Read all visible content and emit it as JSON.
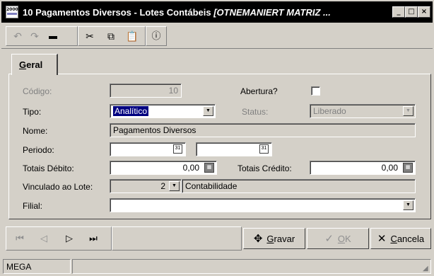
{
  "window": {
    "title_prefix": "10 Pagamentos Diversos - Lotes Contábeis",
    "title_company": "[OTNEMANIERT MATRIZ ...",
    "app_icon_text": "2000",
    "controls": {
      "minimize": "_",
      "maximize": "□",
      "close": "×"
    }
  },
  "toolbar": {
    "icons": [
      "undo-icon",
      "redo-icon",
      "delete-icon",
      "cut-icon",
      "copy-icon",
      "paste-icon",
      "info-icon"
    ]
  },
  "tab": {
    "label_underlined": "G",
    "label_rest": "eral"
  },
  "form": {
    "codigo": {
      "label": "Código:",
      "value": "10"
    },
    "abertura": {
      "label": "Abertura?",
      "checked": false
    },
    "tipo": {
      "label": "Tipo:",
      "value": "Analítico"
    },
    "status": {
      "label": "Status:",
      "value": "Liberado"
    },
    "nome": {
      "label": "Nome:",
      "value": "Pagamentos Diversos"
    },
    "periodo": {
      "label": "Periodo:",
      "start": "",
      "end": ""
    },
    "totais_debito": {
      "label": "Totais Débito:",
      "value": "0,00"
    },
    "totais_credito": {
      "label": "Totais Crédito:",
      "value": "0,00"
    },
    "vinculado": {
      "label": "Vinculado ao Lote:",
      "value": "2",
      "description": "Contabilidade"
    },
    "filial": {
      "label": "Filial:",
      "value": ""
    }
  },
  "nav": {
    "first_glyph": "⏮",
    "prev_glyph": "◁",
    "next_glyph": "▷",
    "last_glyph": "⏭"
  },
  "actions": {
    "gravar_u": "G",
    "gravar_rest": "ravar",
    "ok_u": "O",
    "ok_rest": "K",
    "cancela_u": "C",
    "cancela_rest": "ancela"
  },
  "status_bar": {
    "company": "MEGA",
    "message": ""
  }
}
